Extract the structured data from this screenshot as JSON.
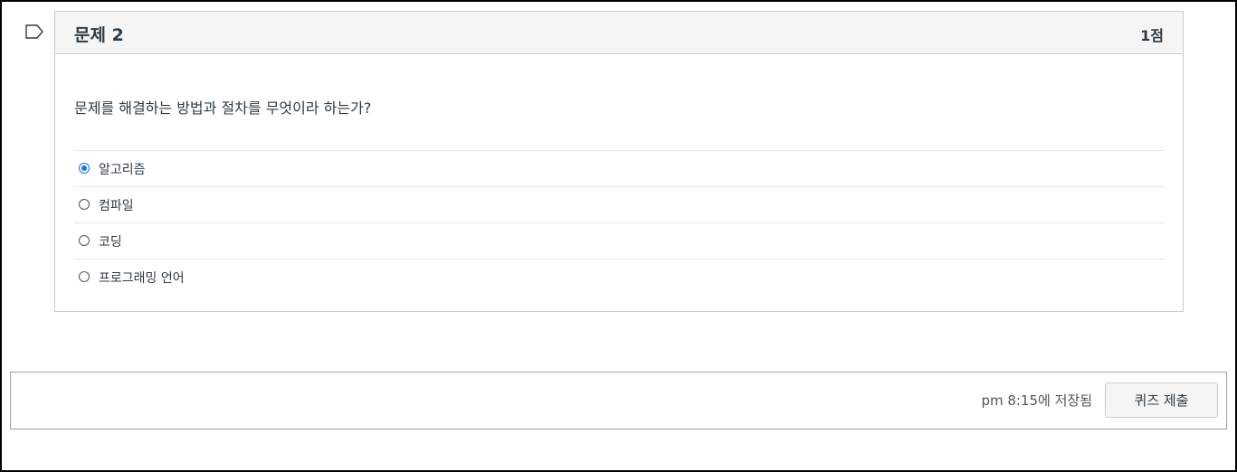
{
  "question": {
    "flag_icon": "flag-outline-icon",
    "title": "문제 2",
    "points": "1점",
    "text": "문제를 해결하는 방법과 절차를 무엇이라 하는가?",
    "answers": [
      {
        "label": "알고리즘",
        "selected": true
      },
      {
        "label": "컴파일",
        "selected": false
      },
      {
        "label": "코딩",
        "selected": false
      },
      {
        "label": "프로그래밍 언어",
        "selected": false
      }
    ]
  },
  "footer": {
    "saved_status": "pm 8:15에 저장됨",
    "submit_label": "퀴즈 제출"
  },
  "colors": {
    "accent": "#1a73e8",
    "header_bg": "#f5f5f5",
    "border": "#c7cdd1"
  }
}
